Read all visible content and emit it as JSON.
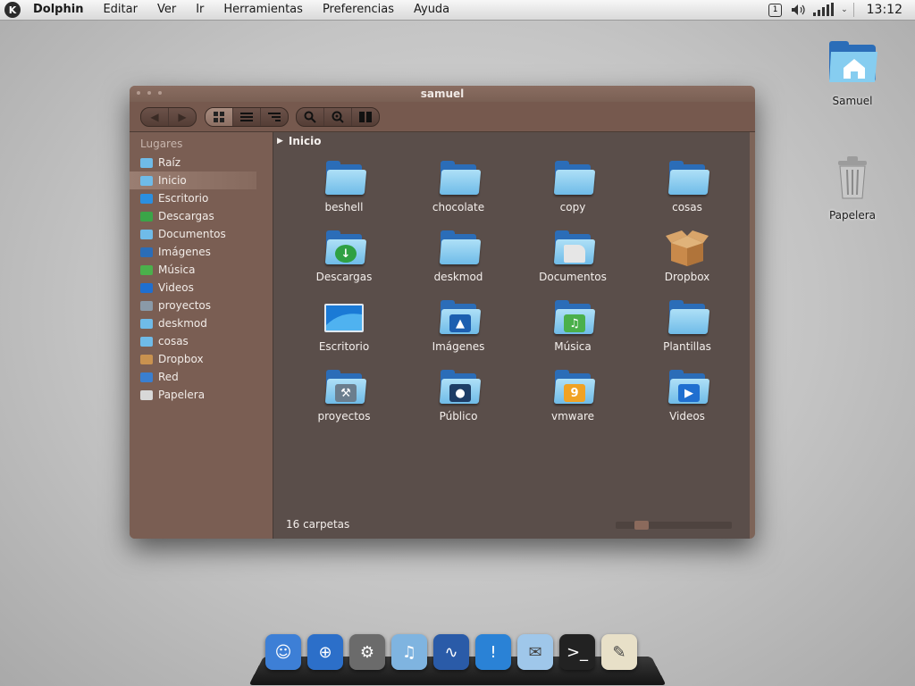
{
  "menubar": {
    "app": "Dolphin",
    "items": [
      "Editar",
      "Ver",
      "Ir",
      "Herramientas",
      "Preferencias",
      "Ayuda"
    ],
    "tray_info": "1",
    "clock": "13:12"
  },
  "desktop": {
    "icons": [
      {
        "label": "Samuel",
        "icon": "home-folder-icon"
      },
      {
        "label": "Papelera",
        "icon": "trash-icon"
      }
    ]
  },
  "window": {
    "title": "samuel",
    "toolbar": {
      "nav": [
        "back-icon",
        "forward-icon"
      ],
      "views": [
        "icons-view-icon",
        "details-view-icon",
        "columns-view-icon"
      ],
      "tools": [
        "search-icon",
        "find-icon",
        "split-view-icon"
      ]
    },
    "sidebar": {
      "heading": "Lugares",
      "items": [
        {
          "label": "Raíz",
          "color": "#6fbbe8"
        },
        {
          "label": "Inicio",
          "color": "#6fbbe8",
          "selected": true
        },
        {
          "label": "Escritorio",
          "color": "#2b8fe0"
        },
        {
          "label": "Descargas",
          "color": "#3aa548"
        },
        {
          "label": "Documentos",
          "color": "#6fbbe8"
        },
        {
          "label": "Imágenes",
          "color": "#2b6db8"
        },
        {
          "label": "Música",
          "color": "#4bb04b"
        },
        {
          "label": "Videos",
          "color": "#1f6fd0"
        },
        {
          "label": "proyectos",
          "color": "#8a9aa8"
        },
        {
          "label": "deskmod",
          "color": "#6fbbe8"
        },
        {
          "label": "cosas",
          "color": "#6fbbe8"
        },
        {
          "label": "Dropbox",
          "color": "#c9924f"
        },
        {
          "label": "Red",
          "color": "#3a7fd0"
        },
        {
          "label": "Papelera",
          "color": "#d8d8d8"
        }
      ]
    },
    "breadcrumb": "Inicio",
    "files": [
      {
        "label": "beshell",
        "emblem": ""
      },
      {
        "label": "chocolate",
        "emblem": ""
      },
      {
        "label": "copy",
        "emblem": ""
      },
      {
        "label": "cosas",
        "emblem": ""
      },
      {
        "label": "Descargas",
        "emblem": "download"
      },
      {
        "label": "deskmod",
        "emblem": ""
      },
      {
        "label": "Documentos",
        "emblem": "document"
      },
      {
        "label": "Dropbox",
        "emblem": "box"
      },
      {
        "label": "Escritorio",
        "emblem": "desktop"
      },
      {
        "label": "Imágenes",
        "emblem": "pictures"
      },
      {
        "label": "Música",
        "emblem": "music"
      },
      {
        "label": "Plantillas",
        "emblem": ""
      },
      {
        "label": "proyectos",
        "emblem": "tools"
      },
      {
        "label": "Público",
        "emblem": "person"
      },
      {
        "label": "vmware",
        "emblem": "vmware"
      },
      {
        "label": "Videos",
        "emblem": "video"
      }
    ],
    "status": "16 carpetas",
    "zoom_level": 0.18
  },
  "dock": {
    "items": [
      {
        "name": "finder-icon",
        "color": "#3d7fd6"
      },
      {
        "name": "safari-icon",
        "color": "#2c6fc9"
      },
      {
        "name": "system-preferences-icon",
        "color": "#6b6b6b"
      },
      {
        "name": "itunes-icon",
        "color": "#7fb4e0"
      },
      {
        "name": "activity-monitor-icon",
        "color": "#2a5ba8"
      },
      {
        "name": "notifications-icon",
        "color": "#2a82d6"
      },
      {
        "name": "mail-icon",
        "color": "#9fc7ea"
      },
      {
        "name": "terminal-icon",
        "color": "#222222"
      },
      {
        "name": "text-editor-icon",
        "color": "#e8e0c8"
      }
    ]
  }
}
